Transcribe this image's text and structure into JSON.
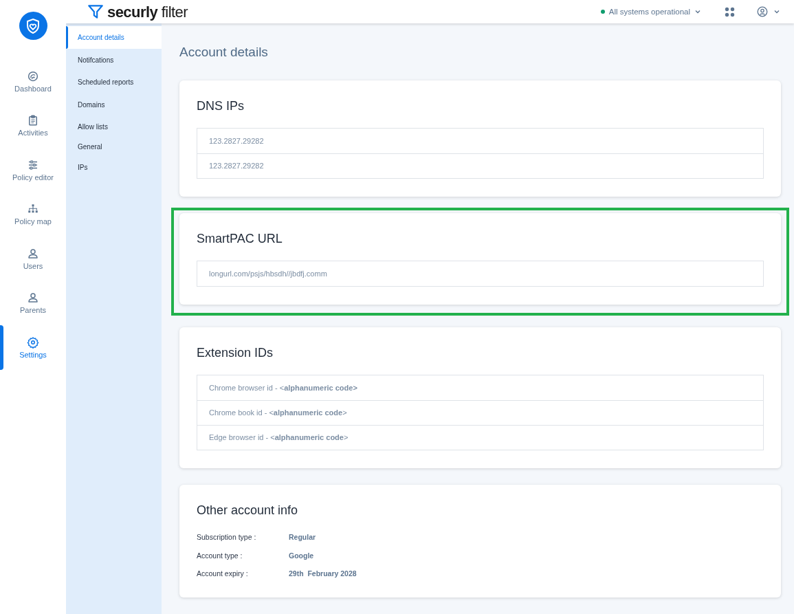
{
  "rail": {
    "items": [
      {
        "label": "Dashboard",
        "kind": "gauge",
        "selected": false
      },
      {
        "label": "Activities",
        "kind": "clipboard",
        "selected": false
      },
      {
        "label": "Policy editor",
        "kind": "sliders",
        "selected": false
      },
      {
        "label": "Policy map",
        "kind": "hierarchy",
        "selected": false
      },
      {
        "label": "Users",
        "kind": "user",
        "selected": false
      },
      {
        "label": "Parents",
        "kind": "user",
        "selected": false
      },
      {
        "label": "Settings",
        "kind": "gear",
        "selected": true
      }
    ]
  },
  "header": {
    "brand": "securly",
    "product": "filter",
    "status": {
      "text": "All systems operational",
      "color": "#0f9d6e"
    }
  },
  "subnav": {
    "items": [
      {
        "label": "Account details",
        "selected": true
      },
      {
        "label": "Notifcations",
        "selected": false
      },
      {
        "label": "Scheduled reports",
        "selected": false
      },
      {
        "label": "Domains",
        "selected": false
      },
      {
        "label": "Allow lists",
        "selected": false
      },
      {
        "label": "General",
        "selected": false
      },
      {
        "label": "IPs",
        "selected": false
      }
    ]
  },
  "page_title": "Account details",
  "cards": [
    {
      "kind": "list",
      "title": "DNS IPs",
      "highlighted": false,
      "rows": [
        "123.2827.29282",
        "123.2827.29282"
      ]
    },
    {
      "kind": "list",
      "title": "SmartPAC URL",
      "highlighted": true,
      "rows": [
        "longurl.com/psjs/hbsdh//jbdfj.comm"
      ]
    },
    {
      "kind": "list",
      "title": "Extension IDs",
      "highlighted": false,
      "rows": [
        "Chrome browser id - <**alphanumeric code>**",
        "Chrome book id - <**alphanumeric code**>",
        "Edge browser id - <**alphanumeric code**>"
      ]
    },
    {
      "kind": "info",
      "title": "Other account info",
      "highlighted": false,
      "fields": [
        {
          "label": "Subscription type :",
          "value": "Regular"
        },
        {
          "label": "Account type :",
          "value": "Google"
        },
        {
          "label": "Account expiry :",
          "value": "29th  February 2028"
        }
      ]
    }
  ]
}
